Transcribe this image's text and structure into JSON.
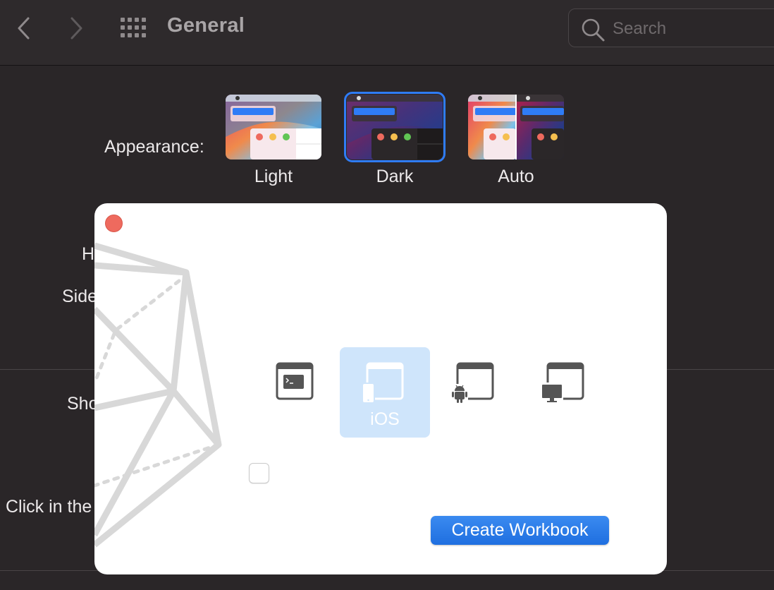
{
  "toolbar": {
    "title": "General",
    "search_placeholder": "Search",
    "icons": [
      "chevron-left-icon",
      "chevron-right-icon",
      "grid-icon",
      "search-icon"
    ]
  },
  "preferences": {
    "appearance_label": "Appearance:",
    "appearance_options": [
      {
        "label": "Light",
        "selected": false
      },
      {
        "label": "Dark",
        "selected": true
      },
      {
        "label": "Auto",
        "selected": false
      }
    ],
    "partial_labels": [
      "H",
      "Side",
      "Sho",
      "Click in the"
    ]
  },
  "sheet": {
    "templates": [
      {
        "name": "terminal-template",
        "label": "",
        "selected": false
      },
      {
        "name": "ios-template",
        "label": "iOS",
        "selected": true
      },
      {
        "name": "android-template",
        "label": "",
        "selected": false
      },
      {
        "name": "desktop-template",
        "label": "",
        "selected": false
      }
    ],
    "checkbox_checked": false,
    "create_button_label": "Create Workbook"
  },
  "colors": {
    "accent": "#2f7cf6",
    "window_background": "#2a2628",
    "sheet_background": "#ffffff",
    "selected_template": "#cfe5fb",
    "close_red": "#ee6a5e"
  }
}
